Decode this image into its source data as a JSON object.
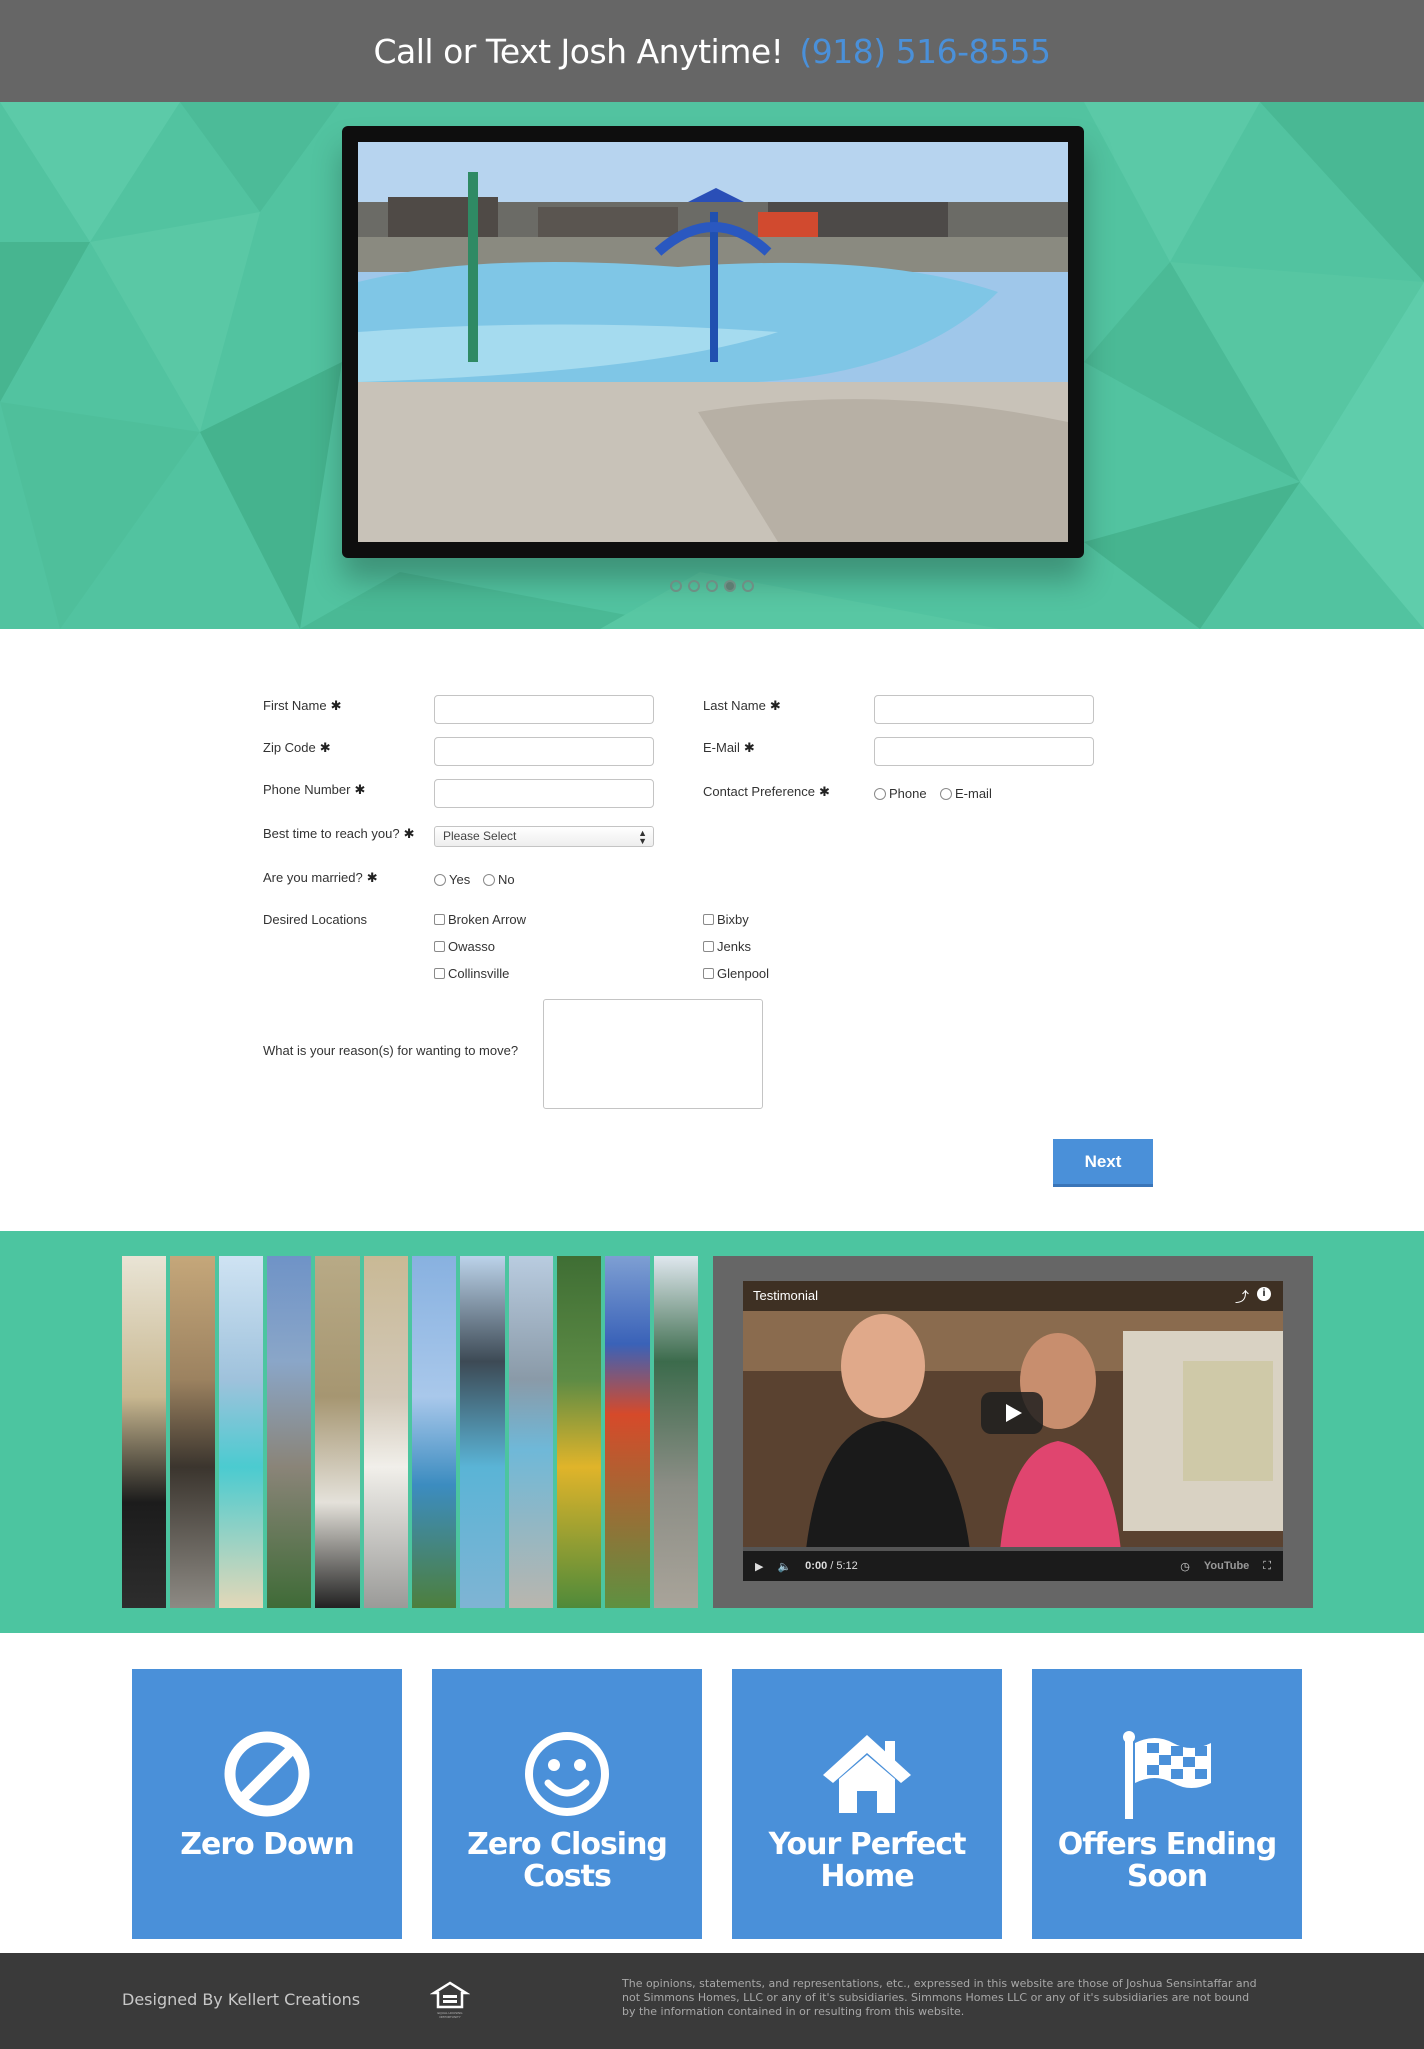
{
  "topbar": {
    "cta": "Call or Text Josh Anytime!",
    "phone": "(918) 516-8555"
  },
  "colors": {
    "topbar": "#666666",
    "hero": "#52c3a0",
    "band": "#4cc5a0",
    "accent_blue": "#4a90d9",
    "footer": "#3a3a3a"
  },
  "slider": {
    "slide_count": 5,
    "active_index": 3
  },
  "form": {
    "first_name": {
      "label": "First Name",
      "required": "✱",
      "value": ""
    },
    "last_name": {
      "label": "Last Name",
      "required": "✱",
      "value": ""
    },
    "zip": {
      "label": "Zip Code",
      "required": "✱",
      "value": ""
    },
    "email": {
      "label": "E-Mail",
      "required": "✱",
      "value": ""
    },
    "phone": {
      "label": "Phone Number",
      "required": "✱",
      "value": ""
    },
    "contact_pref": {
      "label": "Contact Preference",
      "required": "✱",
      "options": [
        "Phone",
        "E-mail"
      ]
    },
    "best_time": {
      "label": "Best time to reach you?",
      "required": "✱",
      "selected": "Please Select"
    },
    "married": {
      "label": "Are you married?",
      "required": "✱",
      "options": [
        "Yes",
        "No"
      ]
    },
    "locations": {
      "label": "Desired Locations",
      "options": [
        "Broken Arrow",
        "Owasso",
        "Collinsville",
        "Bixby",
        "Jenks",
        "Glenpool"
      ]
    },
    "reason": {
      "label": "What is your reason(s) for wanting to move?",
      "value": ""
    },
    "next_label": "Next"
  },
  "video": {
    "title": "Testimonial",
    "time": "0:00",
    "duration": "/ 5:12",
    "brand": "YouTube"
  },
  "tiles": [
    {
      "title": "Zero Down",
      "icon": "no-symbol-icon"
    },
    {
      "title": "Zero Closing Costs",
      "icon": "smiley-icon"
    },
    {
      "title": "Your Perfect Home",
      "icon": "home-icon"
    },
    {
      "title": "Offers Ending Soon",
      "icon": "checkered-flag-icon"
    }
  ],
  "footer": {
    "credit": "Designed By Kellert Creations",
    "eho_label": "EQUAL HOUSING OPPORTUNITY",
    "disclaimer": "The opinions, statements, and representations, etc., expressed in this website are those of Joshua Sensintaffar and not Simmons Homes, LLC or any of it's subsidiaries. Simmons Homes LLC or any of it's subsidiaries are not bound by the information contained in or resulting from this website."
  }
}
